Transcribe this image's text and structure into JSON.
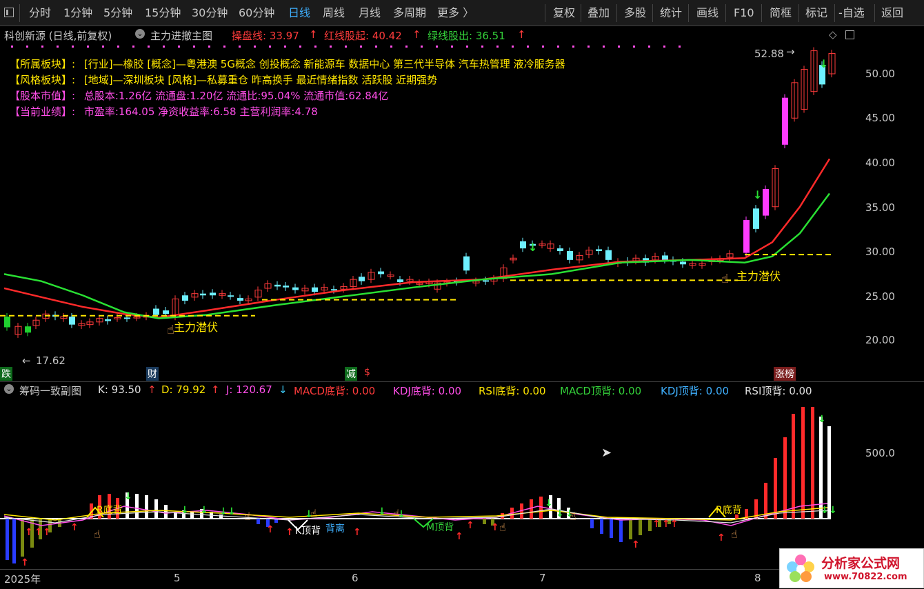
{
  "toolbar": {
    "left": [
      "分时",
      "1分钟",
      "5分钟",
      "15分钟",
      "30分钟",
      "60分钟",
      "日线",
      "周线",
      "月线",
      "多周期",
      "更多 〉"
    ],
    "active": "日线",
    "right": [
      "复权",
      "叠加",
      "多股",
      "统计",
      "画线",
      "F10",
      "简框",
      "标记",
      "-自选",
      "返回"
    ]
  },
  "main": {
    "stock": "科创新源 (日线,前复权)",
    "indicator": "主力进撤主图",
    "items": [
      {
        "label": "操盘线: 33.97",
        "arrow": "↑",
        "color": "#ff3b3b"
      },
      {
        "label": "红线股起: 40.42",
        "arrow": "↑",
        "color": "#ff3b3b"
      },
      {
        "label": "绿线股出: 36.51",
        "arrow": "↑",
        "color": "#34d23a"
      }
    ],
    "info": [
      {
        "label": "【所属板块】:",
        "text": "[行业]—橡胶 [概念]—粤港澳 5G概念 创投概念 新能源车 数据中心 第三代半导体 汽车热管理 液冷服务器",
        "color": "#ffe600"
      },
      {
        "label": "【风格板块】:",
        "text": "[地域]—深圳板块 [风格]—私募重仓 昨高换手 最近情绪指数 活跃股 近期强势",
        "color": "#ffe600"
      },
      {
        "label": "【股本市值】:",
        "text": "总股本:1.26亿 流通盘:1.20亿 流通比:95.04% 流通市值:62.84亿",
        "color": "#ff4ee8"
      },
      {
        "label": "【当前业绩】:",
        "text": "市盈率:164.05 净资收益率:6.58 主营利润率:4.78",
        "color": "#ff4ee8"
      }
    ],
    "price_axis": [
      "50.00",
      "45.00",
      "40.00",
      "35.00",
      "30.00",
      "25.00",
      "20.00"
    ],
    "high_label": "52.88",
    "low_label": "17.62",
    "annotations": [
      "主力潜伏",
      "主力潜伏"
    ],
    "markers": [
      {
        "text": "跌",
        "bg": "#0e6a1c"
      },
      {
        "text": "财",
        "bg": "#1a3a5c"
      },
      {
        "text": "减",
        "bg": "#0e6a1c"
      },
      {
        "text": "$",
        "bg": "#000"
      },
      {
        "text": "涨榜",
        "bg": "#7a1d1d"
      }
    ]
  },
  "sub": {
    "title": "筹码一致副图",
    "items": [
      {
        "label": "K: 93.50",
        "arrow": "↑",
        "color": "#e0e0e0",
        "arrow_color": "#ff3b3b"
      },
      {
        "label": "D: 79.92",
        "arrow": "↑",
        "color": "#ffe600",
        "arrow_color": "#ff3b3b"
      },
      {
        "label": "J: 120.67",
        "arrow": "↓",
        "color": "#ff4ee8",
        "arrow_color": "#3fd0ff"
      },
      {
        "label": "MACD底背: 0.00",
        "color": "#ff3b3b"
      },
      {
        "label": "KDJ底背: 0.00",
        "color": "#ff4ee8"
      },
      {
        "label": "RSI底背: 0.00",
        "color": "#ffe600"
      },
      {
        "label": "MACD顶背: 0.00",
        "color": "#34d23a"
      },
      {
        "label": "KDJ顶背: 0.00",
        "color": "#3fb0ff"
      },
      {
        "label": "RSI顶背: 0.00",
        "color": "#e0e0e0"
      }
    ],
    "axis": "500.0",
    "labels": [
      "R底背",
      "R底背",
      "K顶背",
      "M顶背",
      "背离"
    ]
  },
  "time_axis": [
    "2025年",
    "5",
    "6",
    "7",
    "8"
  ],
  "watermark": {
    "title": "分析家公式网",
    "url": "www.70822.com"
  }
}
